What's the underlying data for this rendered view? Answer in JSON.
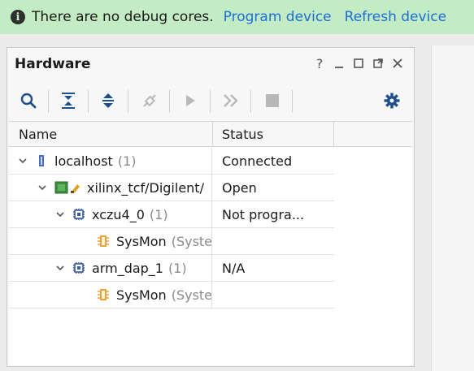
{
  "banner": {
    "icon": "info-icon",
    "message": "There are no debug cores.",
    "program_link": "Program device",
    "refresh_link": "Refresh device",
    "bg_color": "#c4ecc4",
    "link_color": "#1a6fd6"
  },
  "panel": {
    "title": "Hardware",
    "controls": {
      "help": "?",
      "minimize": "_",
      "maximize": "□",
      "float": "float-icon",
      "close": "close-icon"
    }
  },
  "toolbar": {
    "buttons": [
      "search-icon",
      "collapse-all-icon",
      "expand-all-icon",
      "auto-connect-icon",
      "run-icon",
      "step-icon",
      "stop-icon",
      "gear-icon"
    ]
  },
  "tree": {
    "columns": {
      "name": "Name",
      "status": "Status"
    },
    "rows": [
      {
        "name": "localhost",
        "count": "(1)",
        "status": "Connected",
        "icon": "server-icon",
        "expanded": true
      },
      {
        "name": "xilinx_tcf/Digilent/",
        "count": "",
        "status": "Open",
        "icon": "jtag-cable-icon",
        "expanded": true
      },
      {
        "name": "xczu4_0",
        "count": "(1)",
        "status": "Not progra...",
        "icon": "chip-icon",
        "expanded": true
      },
      {
        "name": "SysMon",
        "sub": "(System Monitor)",
        "status": "",
        "icon": "sysmon-icon"
      },
      {
        "name": "arm_dap_1",
        "count": "(1)",
        "status": "N/A",
        "icon": "chip-icon",
        "expanded": true
      },
      {
        "name": "SysMon",
        "sub": "(System Monitor)",
        "status": "",
        "icon": "sysmon-icon"
      }
    ]
  }
}
